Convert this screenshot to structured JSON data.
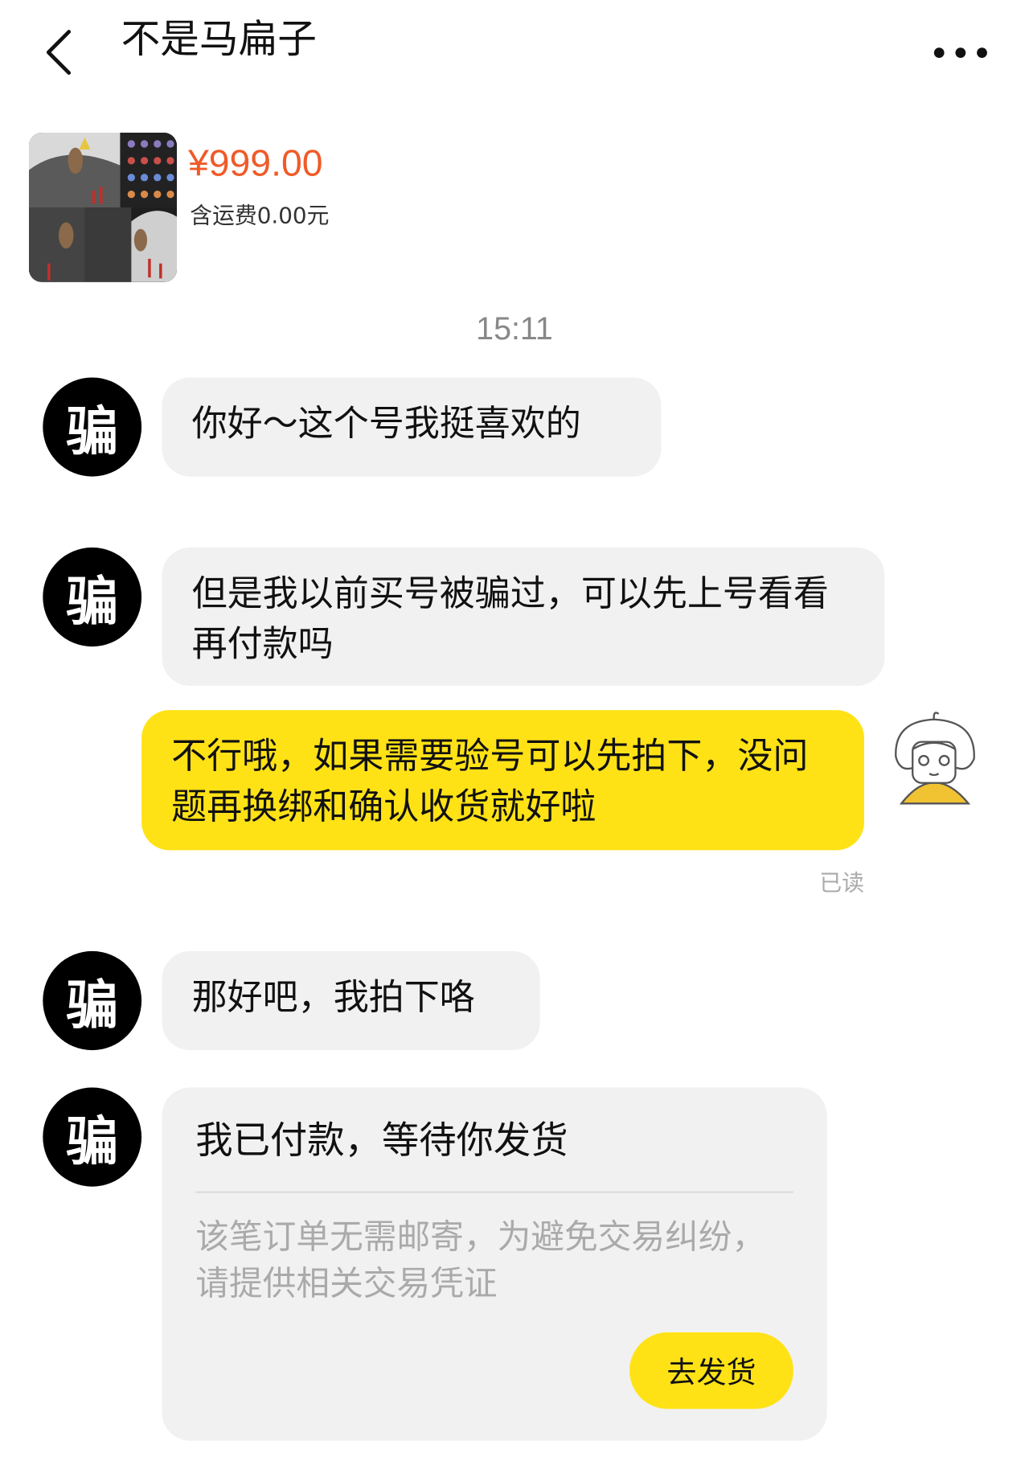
{
  "header": {
    "title": "不是马扁子"
  },
  "product": {
    "price": "¥999.00",
    "shipping": "含运费0.00元"
  },
  "chat": {
    "timestamp": "15:11",
    "seller_avatar_text": "骗",
    "messages": [
      {
        "from": "seller",
        "text": "你好～这个号我挺喜欢的"
      },
      {
        "from": "seller",
        "text": "但是我以前买号被骗过，可以先上号看看再付款吗"
      },
      {
        "from": "me",
        "text": "不行哦，如果需要验号可以先拍下，没问题再换绑和确认收货就好啦",
        "status": "已读"
      },
      {
        "from": "seller",
        "text": "那好吧，我拍下咯"
      }
    ],
    "order_card": {
      "title": "我已付款，等待你发货",
      "note": "该笔订单无需邮寄，为避免交易纠纷，请提供相关交易凭证",
      "button_label": "去发货"
    }
  },
  "colors": {
    "accent_yellow": "#ffe216",
    "price_orange": "#f05a28",
    "bubble_gray": "#f1f1f1"
  },
  "icons": {
    "back": "chevron-left-icon",
    "more": "more-dots-icon"
  }
}
